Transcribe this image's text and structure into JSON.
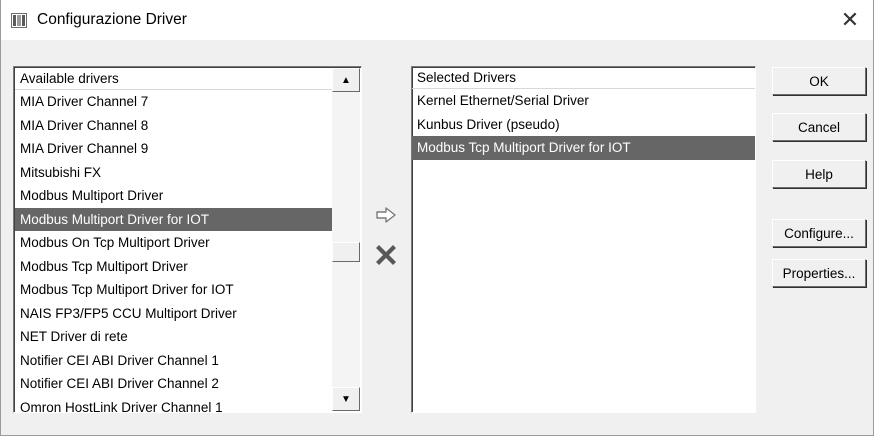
{
  "window": {
    "title": "Configurazione Driver",
    "close_glyph": "✕",
    "icon": "app-window-icon"
  },
  "available": {
    "header": "Available drivers",
    "items": [
      "MIA Driver Channel 7",
      "MIA Driver Channel 8",
      "MIA Driver Channel 9",
      "Mitsubishi FX",
      "Modbus Multiport Driver",
      "Modbus Multiport Driver for IOT",
      "Modbus On Tcp Multiport Driver",
      "Modbus Tcp Multiport Driver",
      "Modbus Tcp Multiport Driver for IOT",
      "NAIS FP3/FP5 CCU Multiport Driver",
      "NET Driver di rete",
      "Notifier CEI ABI Driver Channel 1",
      "Notifier CEI ABI Driver Channel 2",
      "Omron HostLink Driver Channel 1"
    ],
    "selected_item": "Modbus Multiport Driver for IOT",
    "scroll_up_glyph": "▲",
    "scroll_down_glyph": "▼"
  },
  "selected": {
    "header": "Selected Drivers",
    "items": [
      "Kernel Ethernet/Serial Driver",
      "Kunbus Driver (pseudo)",
      "Modbus Tcp Multiport Driver for IOT"
    ],
    "selected_item": "Modbus Tcp Multiport Driver for IOT"
  },
  "transfer": {
    "add_icon": "arrow-right-icon",
    "remove_icon": "x-remove-icon"
  },
  "buttons": {
    "ok": "OK",
    "cancel": "Cancel",
    "help": "Help",
    "configure": "Configure...",
    "properties": "Properties..."
  },
  "colors": {
    "selection_bg": "#666666",
    "selection_text": "#ffffff",
    "dialog_bg": "#f0f0f0"
  }
}
